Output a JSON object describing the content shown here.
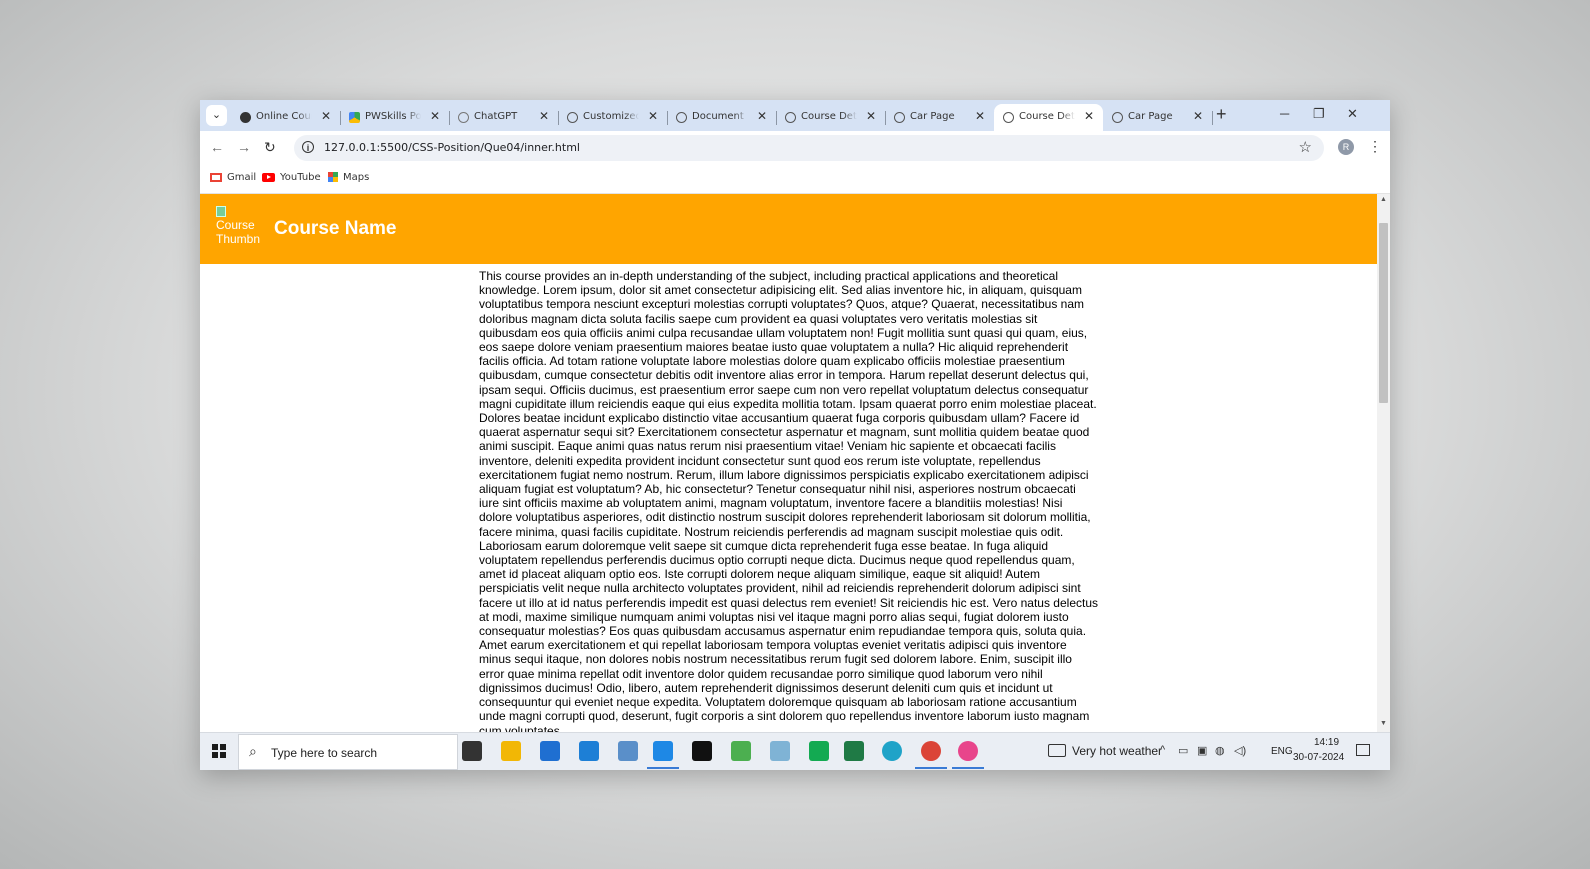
{
  "browser": {
    "tabs": [
      {
        "title": "Online Courses",
        "favicon": "dark-globe-icon",
        "active": false
      },
      {
        "title": "PWSkills Posts",
        "favicon": "drive-icon",
        "active": false
      },
      {
        "title": "ChatGPT",
        "favicon": "chatgpt-icon",
        "active": false
      },
      {
        "title": "Customized Form",
        "favicon": "globe-icon",
        "active": false
      },
      {
        "title": "Document",
        "favicon": "globe-icon",
        "active": false
      },
      {
        "title": "Course Details",
        "favicon": "globe-icon",
        "active": false
      },
      {
        "title": "Car Page",
        "favicon": "globe-icon",
        "active": false
      },
      {
        "title": "Course Details",
        "favicon": "globe-icon",
        "active": true
      },
      {
        "title": "Car Page",
        "favicon": "globe-icon",
        "active": false
      }
    ],
    "close_glyph": "✕",
    "new_tab_glyph": "+",
    "url": "127.0.0.1:5500/CSS-Position/Que04/inner.html",
    "profile_initial": "R",
    "bookmarks": [
      {
        "label": "Gmail",
        "icon": "gmail-icon"
      },
      {
        "label": "YouTube",
        "icon": "youtube-icon"
      },
      {
        "label": "Maps",
        "icon": "maps-icon"
      }
    ]
  },
  "page": {
    "header_bg": "#ffa500",
    "thumbnail_alt": "Course Thumbnail",
    "course_name": "Course Name",
    "description": "This course provides an in-depth understanding of the subject, including practical applications and theoretical knowledge. Lorem ipsum, dolor sit amet consectetur adipisicing elit. Sed alias inventore hic, in aliquam, quisquam voluptatibus tempora nesciunt excepturi molestias corrupti voluptates? Quos, atque? Quaerat, necessitatibus nam doloribus magnam dicta soluta facilis saepe cum provident ea quasi voluptates vero veritatis molestias sit quibusdam eos quia officiis animi culpa recusandae ullam voluptatem non! Fugit mollitia sunt quasi qui quam, eius, eos saepe dolore veniam praesentium maiores beatae iusto quae voluptatem a nulla? Hic aliquid reprehenderit facilis officia. Ad totam ratione voluptate labore molestias dolore quam explicabo officiis molestiae praesentium quibusdam, cumque consectetur debitis odit inventore alias error in tempora. Harum repellat deserunt delectus qui, ipsam sequi. Officiis ducimus, est praesentium error saepe cum non vero repellat voluptatum delectus consequatur magni cupiditate illum reiciendis eaque qui eius expedita mollitia totam. Ipsam quaerat porro enim molestiae placeat. Dolores beatae incidunt explicabo distinctio vitae accusantium quaerat fuga corporis quibusdam ullam? Facere id quaerat aspernatur sequi sit? Exercitationem consectetur aspernatur et magnam, sunt mollitia quidem beatae quod animi suscipit. Eaque animi quas natus rerum nisi praesentium vitae! Veniam hic sapiente et obcaecati facilis inventore, deleniti expedita provident incidunt consectetur sunt quod eos rerum iste voluptate, repellendus exercitationem fugiat nemo nostrum. Rerum, illum labore dignissimos perspiciatis explicabo exercitationem adipisci aliquam fugiat est voluptatum? Ab, hic consectetur? Tenetur consequatur nihil nisi, asperiores nostrum obcaecati iure sint officiis maxime ab voluptatem animi, magnam voluptatum, inventore facere a blanditiis molestias! Nisi dolore voluptatibus asperiores, odit distinctio nostrum suscipit dolores reprehenderit laboriosam sit dolorum mollitia, facere minima, quasi facilis cupiditate. Nostrum reiciendis perferendis ad magnam suscipit molestiae quis odit. Laboriosam earum doloremque velit saepe sit cumque dicta reprehenderit fuga esse beatae. In fuga aliquid voluptatem repellendus perferendis ducimus optio corrupti neque dicta. Ducimus neque quod repellendus quam, amet id placeat aliquam optio eos. Iste corrupti dolorem neque aliquam similique, eaque sit aliquid! Autem perspiciatis velit neque nulla architecto voluptates provident, nihil ad reiciendis reprehenderit dolorum adipisci sint facere ut illo at id natus perferendis impedit est quasi delectus rem eveniet! Sit reiciendis hic est. Vero natus delectus at modi, maxime similique numquam animi voluptas nisi vel itaque magni porro alias sequi, fugiat dolorem iusto consequatur molestias? Eos quas quibusdam accusamus aspernatur enim repudiandae tempora quis, soluta quia. Amet earum exercitationem et qui repellat laboriosam tempora voluptas eveniet veritatis adipisci quis inventore minus sequi itaque, non dolores nobis nostrum necessitatibus rerum fugit sed dolorem labore. Enim, suscipit illo error quae minima repellat odit inventore dolor quidem recusandae porro similique quod laborum vero nihil dignissimos ducimus! Odio, libero, autem reprehenderit dignissimos deserunt deleniti cum quis et incidunt ut consequuntur qui eveniet neque expedita. Voluptatem doloremque quisquam ab laboriosam ratione accusantium unde magni corrupti quod, deserunt, fugit corporis a sint dolorem quo repellendus inventore laborum iusto magnam cum voluptates"
  },
  "taskbar": {
    "search_placeholder": "Type here to search",
    "weather": "Very hot weather",
    "language": "ENG",
    "time": "14:19",
    "date": "30-07-2024",
    "apps": [
      {
        "name": "task-view-icon",
        "color": "#333333"
      },
      {
        "name": "file-explorer-icon",
        "color": "#f2b705"
      },
      {
        "name": "store-icon",
        "color": "#1f6fd1"
      },
      {
        "name": "mail-icon",
        "color": "#1d7fd6"
      },
      {
        "name": "files-icon",
        "color": "#5a8fc9"
      },
      {
        "name": "vscode-icon",
        "color": "#1e88e5"
      },
      {
        "name": "terminal-icon",
        "color": "#111111"
      },
      {
        "name": "node-icon",
        "color": "#4caf50"
      },
      {
        "name": "app-icon",
        "color": "#7fb3d5"
      },
      {
        "name": "mongodb-compass-icon",
        "color": "#13aa52"
      },
      {
        "name": "mongodb-icon",
        "color": "#1f7a45"
      },
      {
        "name": "edge-icon",
        "color": "#1fa3c8"
      },
      {
        "name": "chrome-icon",
        "color": "#db4437"
      },
      {
        "name": "paint-icon",
        "color": "#e8458b"
      }
    ]
  }
}
